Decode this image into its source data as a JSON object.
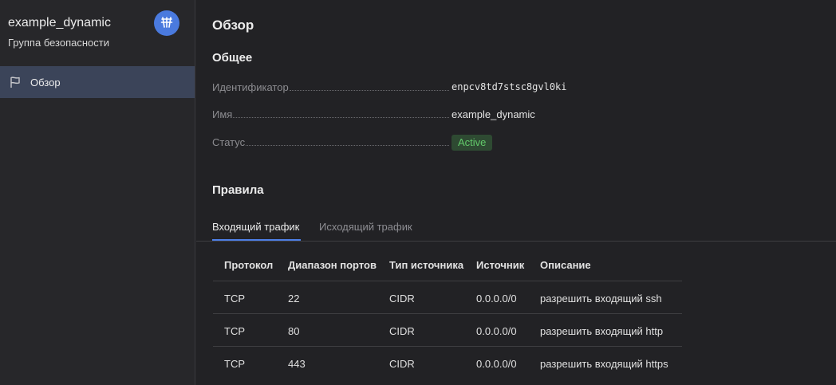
{
  "sidebar": {
    "title": "example_dynamic",
    "subtitle": "Группа безопасности",
    "service_icon": "network-icon",
    "items": [
      {
        "label": "Обзор",
        "icon": "flag-icon",
        "active": true
      }
    ]
  },
  "main": {
    "page_title": "Обзор",
    "general": {
      "title": "Общее",
      "properties": [
        {
          "key": "Идентификатор",
          "value": "enpcv8td7stsc8gvl0ki"
        },
        {
          "key": "Имя",
          "value": "example_dynamic"
        },
        {
          "key": "Статус",
          "value": "Active"
        }
      ]
    },
    "rules": {
      "title": "Правила",
      "tabs": [
        {
          "label": "Входящий трафик",
          "active": true
        },
        {
          "label": "Исходящий трафик",
          "active": false
        }
      ],
      "columns": [
        "Протокол",
        "Диапазон портов",
        "Тип источника",
        "Источник",
        "Описание"
      ],
      "rows": [
        [
          "TCP",
          "22",
          "CIDR",
          "0.0.0.0/0",
          "разрешить входящий ssh"
        ],
        [
          "TCP",
          "80",
          "CIDR",
          "0.0.0.0/0",
          "разрешить входящий http"
        ],
        [
          "TCP",
          "443",
          "CIDR",
          "0.0.0.0/0",
          "разрешить входящий https"
        ]
      ]
    }
  },
  "colors": {
    "accent": "#4d7fe6",
    "status_active_bg": "#2e4a32",
    "status_active_text": "#62c96a",
    "sidebar_active_bg": "#3b4459"
  }
}
